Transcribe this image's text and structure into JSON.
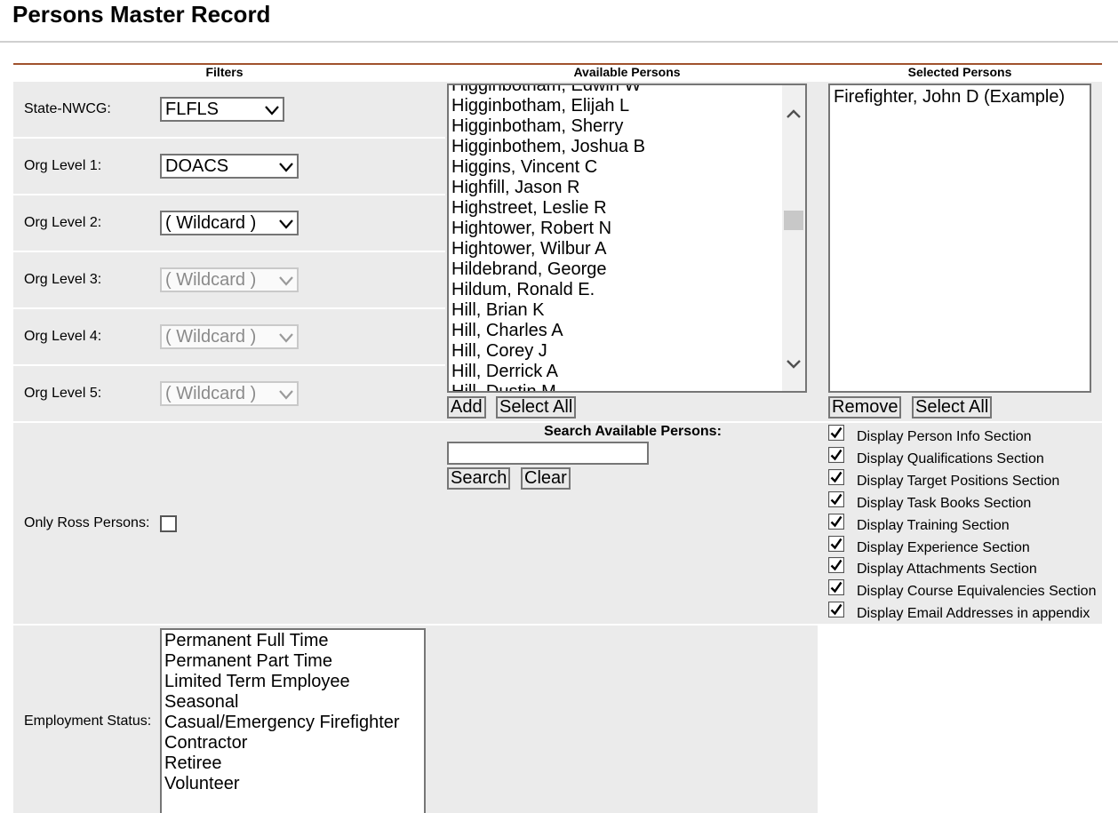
{
  "page": {
    "title": "Persons Master Record"
  },
  "headers": {
    "filters": "Filters",
    "available": "Available Persons",
    "selected": "Selected Persons"
  },
  "filters": {
    "state_label": "State-NWCG:",
    "state_value": "FLFLS",
    "org1_label": "Org Level 1:",
    "org1_value": "DOACS",
    "org2_label": "Org Level 2:",
    "org2_value": "( Wildcard )",
    "org3_label": "Org Level 3:",
    "org3_value": "( Wildcard )",
    "org4_label": "Org Level 4:",
    "org4_value": "( Wildcard )",
    "org5_label": "Org Level 5:",
    "org5_value": "( Wildcard )",
    "ross_label": "Only Ross Persons:",
    "employment_label": "Employment Status:",
    "employment_options": [
      "Permanent Full Time",
      "Permanent Part Time",
      "Limited Term Employee",
      "Seasonal",
      "Casual/Emergency Firefighter",
      "Contractor",
      "Retiree",
      "Volunteer"
    ]
  },
  "available": {
    "items": [
      "Higginbotham, Edwin W",
      "Higginbotham, Elijah L",
      "Higginbotham, Sherry",
      "Higginbothem, Joshua B",
      "Higgins, Vincent C",
      "Highfill, Jason R",
      "Highstreet, Leslie R",
      "Hightower, Robert N",
      "Hightower, Wilbur A",
      "Hildebrand, George",
      "Hildum, Ronald E.",
      "Hill, Brian K",
      "Hill, Charles A",
      "Hill, Corey J",
      "Hill, Derrick A",
      "Hill, Dustin M"
    ],
    "add_label": "Add",
    "select_all_label": "Select All"
  },
  "search": {
    "label": "Search Available Persons:",
    "value": "",
    "search_label": "Search",
    "clear_label": "Clear"
  },
  "selected": {
    "items": [
      "Firefighter, John D (Example)"
    ],
    "remove_label": "Remove",
    "select_all_label": "Select All"
  },
  "display_options": [
    "Display Person Info Section",
    "Display Qualifications Section",
    "Display Target Positions Section",
    "Display Task Books Section",
    "Display Training Section",
    "Display Experience Section",
    "Display Attachments Section",
    "Display Course Equivalencies Section",
    "Display Email Addresses in appendix"
  ]
}
